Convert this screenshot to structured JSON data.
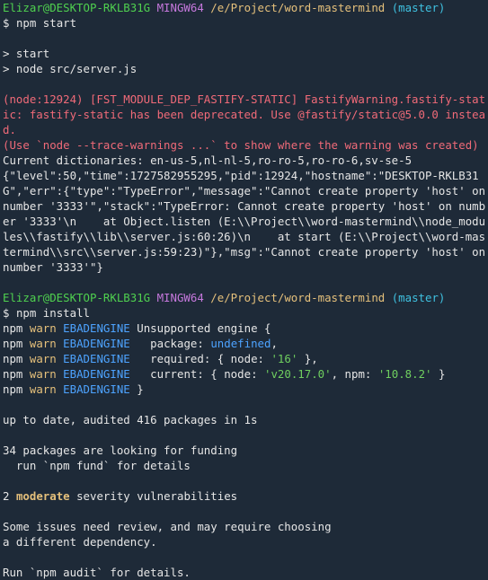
{
  "terminal": {
    "colors": {
      "background": "#1e2a38",
      "user": "#4fd14f",
      "shell": "#c678dd",
      "path": "#e5c07b",
      "branch": "#3fc1e0",
      "warning": "#f06a78"
    },
    "prompt1": {
      "user": "Elizar@DESKTOP-RKLB31G",
      "shell": "MINGW64",
      "path": "/e/Project/word-mastermind",
      "branch": "(master)",
      "dollar": "$",
      "command": "npm start"
    },
    "start_output": {
      "l1": "> start",
      "l2": "> node src/server.js"
    },
    "node_warning": {
      "l1": "(node:12924) [FST_MODULE_DEP_FASTIFY-STATIC] FastifyWarning.fastify-static: fastify-static has been deprecated. Use @fastify/static@5.0.0 instead.",
      "l2": "(Use `node --trace-warnings ...` to show where the warning was created)"
    },
    "dictionaries": "Current dictionaries: en-us-5,nl-nl-5,ro-ro-5,ro-ro-6,sv-se-5",
    "error_json": "{\"level\":50,\"time\":1727582955295,\"pid\":12924,\"hostname\":\"DESKTOP-RKLB31G\",\"err\":{\"type\":\"TypeError\",\"message\":\"Cannot create property 'host' on number '3333'\",\"stack\":\"TypeError: Cannot create property 'host' on number '3333'\\n    at Object.listen (E:\\\\Project\\\\word-mastermind\\\\node_modules\\\\fastify\\\\lib\\\\server.js:60:26)\\n    at start (E:\\\\Project\\\\word-mastermind\\\\src\\\\server.js:59:23)\"},\"msg\":\"Cannot create property 'host' on number '3333'\"}",
    "prompt2": {
      "user": "Elizar@DESKTOP-RKLB31G",
      "shell": "MINGW64",
      "path": "/e/Project/word-mastermind",
      "branch": "(master)",
      "dollar": "$",
      "command": "npm install"
    },
    "npm_warn": {
      "npm": "npm",
      "warn": "warn",
      "code": "EBADENGINE",
      "rows": [
        {
          "text": "Unsupported engine {"
        },
        {
          "pre": "  package: ",
          "val": "undefined",
          "post": ","
        },
        {
          "pre": "  required: { node: ",
          "val": "'16'",
          "post": " },"
        },
        {
          "pre": "  current: { node: ",
          "val": "'v20.17.0'",
          "mid": ", npm: ",
          "val2": "'10.8.2'",
          "post": " }"
        },
        {
          "text": "}"
        }
      ]
    },
    "install_output": {
      "audited": "up to date, audited 416 packages in 1s",
      "funding1": "34 packages are looking for funding",
      "funding2": "  run `npm fund` for details",
      "vuln_count": "2",
      "vuln_level": "moderate",
      "vuln_rest": "severity vulnerabilities",
      "issues1": "Some issues need review, and may require choosing",
      "issues2": "a different dependency.",
      "audit": "Run `npm audit` for details."
    }
  }
}
